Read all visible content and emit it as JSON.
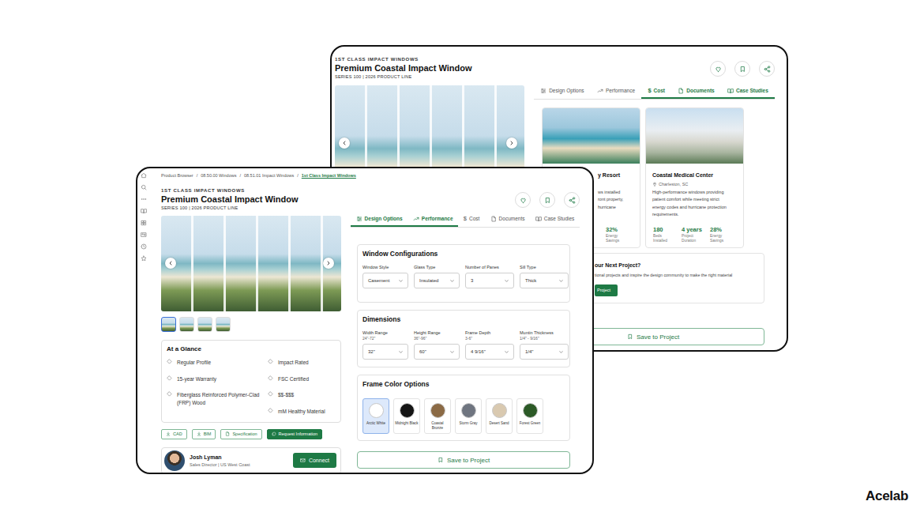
{
  "back": {
    "brand": "1ST CLASS IMPACT WINDOWS",
    "title": "Premium Coastal Impact Window",
    "series": "SERIES 100 | 2026 PRODUCT LINE",
    "tabs": [
      {
        "label": "Design Options",
        "selected": false
      },
      {
        "label": "Performance",
        "selected": false
      },
      {
        "label": "Cost",
        "icon": "$",
        "selected": true
      },
      {
        "label": "Documents",
        "selected": true
      },
      {
        "label": "Case Studies",
        "selected": true
      }
    ],
    "cases": [
      {
        "title": "y Resort",
        "lines": [
          "ws installed",
          "ront property,",
          "hurricane"
        ],
        "stats": [
          {
            "value": "32%",
            "label": "Energy Savings"
          }
        ]
      },
      {
        "title": "Coastal Medical Center",
        "location": "Charleston, SC",
        "lines": [
          "High-performance windows providing",
          "patient comfort while meeting strict",
          "energy codes and hurricane protection",
          "requirements."
        ],
        "stats": [
          {
            "value": "180",
            "label": "Beds Installed"
          },
          {
            "value": "4 years",
            "label": "Project Duration"
          },
          {
            "value": "28%",
            "label": "Energy Savings"
          }
        ]
      }
    ],
    "cta": {
      "title": "our Next Project?",
      "text": "tional projects and inspire the design community to make the right material",
      "button": "Project"
    },
    "save": "Save to Project"
  },
  "front": {
    "breadcrumb": {
      "separator": "/",
      "items": [
        {
          "label": "Product Browser",
          "selected": false
        },
        {
          "label": "08.50.00 Windows",
          "selected": false
        },
        {
          "label": "08.51.01 Impact Windows",
          "selected": false
        },
        {
          "label": "1st Class Impact Windows",
          "selected": true
        }
      ]
    },
    "brand": "1ST CLASS IMPACT WINDOWS",
    "title": "Premium Coastal Impact Window",
    "series": "SERIES 100 | 2026 PRODUCT LINE",
    "thumbnails": [
      {
        "selected": true
      },
      {
        "selected": false
      },
      {
        "selected": false
      },
      {
        "selected": false
      }
    ],
    "at_a_glance": {
      "title": "At a Glance",
      "left": [
        "Regular Profile",
        "15-year Warranty",
        "Fiberglass Reinforced Polymer-Clad (FRP) Wood"
      ],
      "right": [
        "Impact Rated",
        "FSC Certified",
        "$$-$$$",
        "mM Healthy Material"
      ]
    },
    "actions": [
      {
        "label": "CAD",
        "kind": "outline"
      },
      {
        "label": "BIM",
        "kind": "outline"
      },
      {
        "label": "Specification",
        "kind": "outline"
      },
      {
        "label": "Request Information",
        "kind": "filled"
      }
    ],
    "contact": {
      "name": "Josh Lyman",
      "role": "Sales Director | US West Coast",
      "button": "Connect"
    },
    "tabs": [
      {
        "label": "Design Options",
        "selected": true
      },
      {
        "label": "Performance",
        "selected": true
      },
      {
        "label": "Cost",
        "icon": "$",
        "selected": false
      },
      {
        "label": "Documents",
        "selected": false
      },
      {
        "label": "Case Studies",
        "selected": false
      }
    ],
    "configurations": {
      "title": "Window Configurations",
      "fields": [
        {
          "label": "Window Style",
          "value": "Casement"
        },
        {
          "label": "Glass Type",
          "value": "Insulated"
        },
        {
          "label": "Number of Panes",
          "value": "3"
        },
        {
          "label": "Sill Type",
          "value": "Thick"
        }
      ]
    },
    "dimensions": {
      "title": "Dimensions",
      "fields": [
        {
          "label": "Width Range",
          "range": "24\"-72\"",
          "value": "32\""
        },
        {
          "label": "Height Range",
          "range": "36\"-96\"",
          "value": "60\""
        },
        {
          "label": "Frame Depth",
          "range": "3-6\"",
          "value": "4 9/16\""
        },
        {
          "label": "Muntin Thickness",
          "range": "1/4\" - 9/16\"",
          "value": "1/4\""
        }
      ]
    },
    "frame_colors": {
      "title": "Frame Color Options",
      "options": [
        {
          "label": "Arctic White",
          "color": "#ffffff",
          "selected": true
        },
        {
          "label": "Midnight Black",
          "color": "#151515",
          "selected": false
        },
        {
          "label": "Coastal Bronze",
          "color": "#8b6a45",
          "selected": false
        },
        {
          "label": "Storm Gray",
          "color": "#6f7580",
          "selected": false
        },
        {
          "label": "Desert Sand",
          "color": "#d9c9b0",
          "selected": false
        },
        {
          "label": "Forest Green",
          "color": "#2c5a27",
          "selected": false
        }
      ]
    },
    "save": "Save to Project"
  },
  "logo": "Acelab"
}
